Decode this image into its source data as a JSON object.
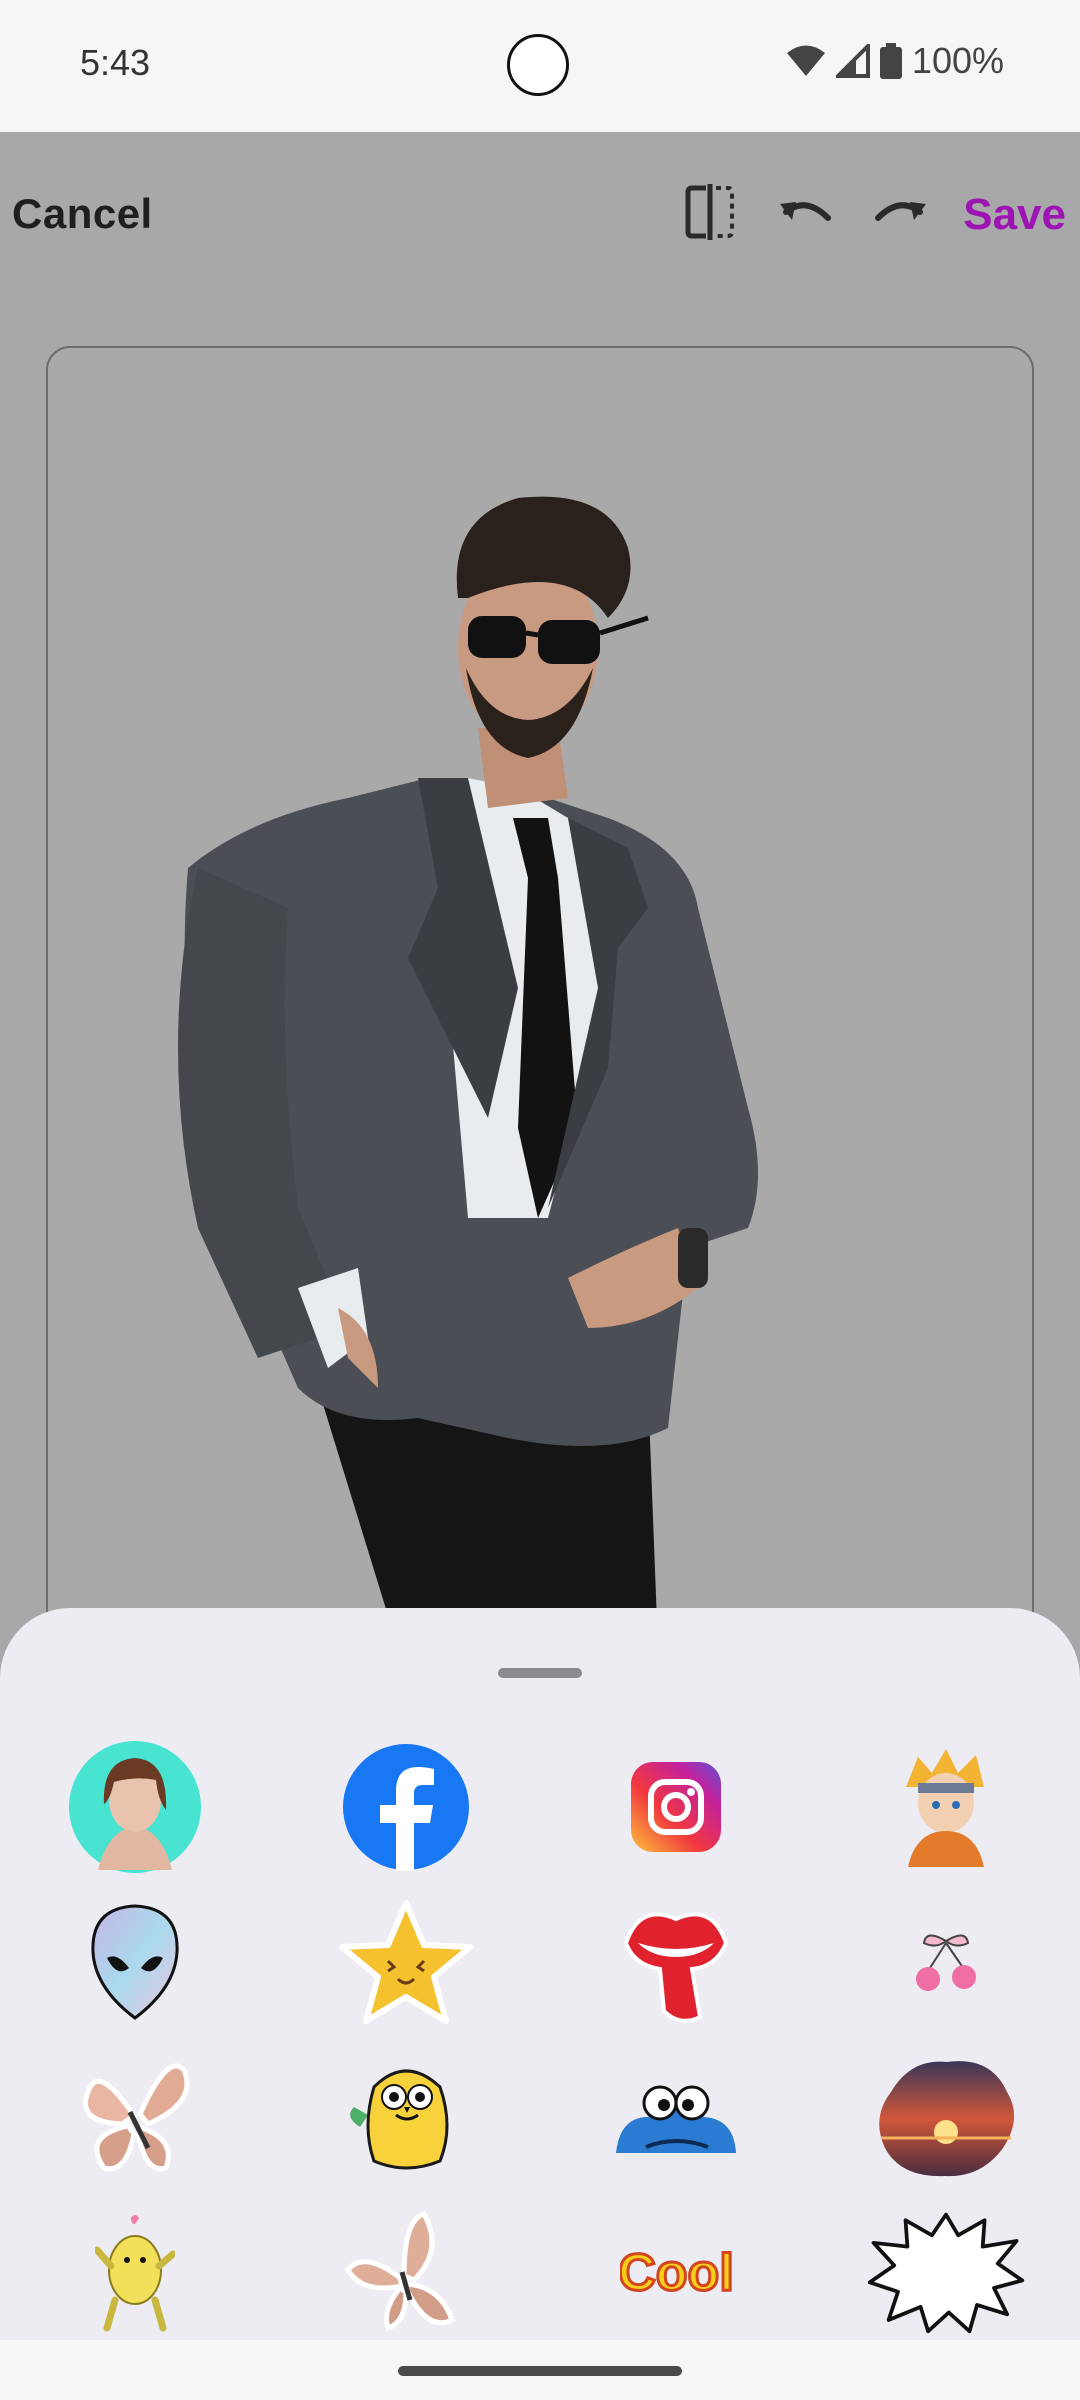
{
  "status_bar": {
    "time": "5:43",
    "battery": "100%",
    "icons": [
      "wifi-icon",
      "signal-icon",
      "battery-icon"
    ]
  },
  "toolbar": {
    "cancel_label": "Cancel",
    "save_label": "Save",
    "icons": [
      "compare-icon",
      "undo-icon",
      "redo-icon"
    ],
    "save_color": "#9c15b3"
  },
  "canvas": {
    "subject": "photo-man-in-suit"
  },
  "sticker_sheet": {
    "stickers": [
      "woman-portrait-sticker",
      "facebook-logo-sticker",
      "instagram-logo-sticker",
      "anime-boy-sticker",
      "holographic-alien-sticker",
      "smiling-star-sticker",
      "lips-tongue-sticker",
      "cherries-bow-sticker",
      "butterfly-sticker",
      "yellow-dog-sticker",
      "blue-monster-sticker",
      "sunset-clouds-sticker",
      "dancing-creature-sticker",
      "butterfly-2-sticker",
      "cool-text-sticker",
      "speech-burst-sticker"
    ],
    "cool_text": "Cool"
  }
}
